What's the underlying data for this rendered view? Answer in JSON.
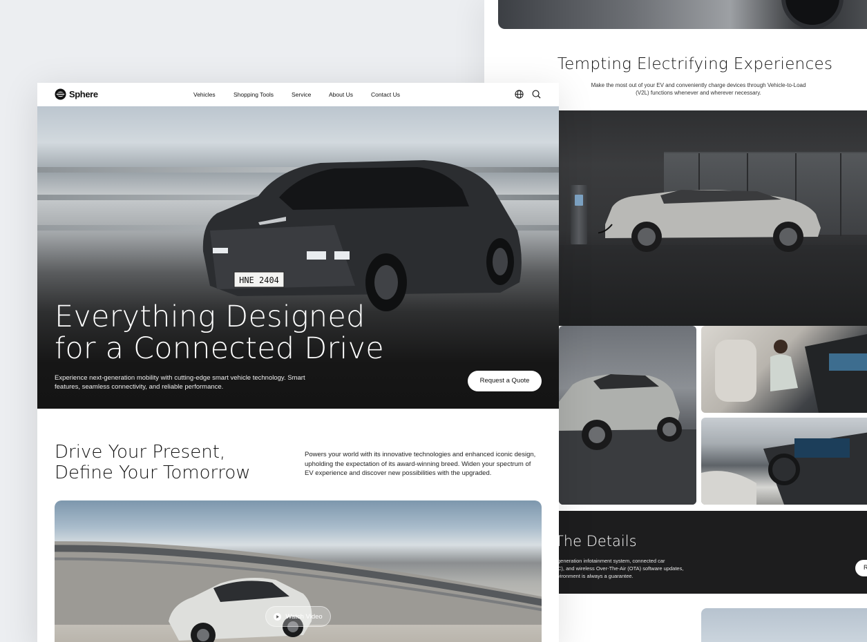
{
  "brand": {
    "name": "Sphere"
  },
  "nav": {
    "links": [
      "Vehicles",
      "Shopping Tools",
      "Service",
      "About Us",
      "Contact Us"
    ],
    "icons": [
      "globe-icon",
      "search-icon"
    ]
  },
  "hero": {
    "title_line1": "Everything Designed",
    "title_line2": "for a Connected Drive",
    "subtitle": "Experience next-generation mobility with cutting-edge smart vehicle technology. Smart features, seamless connectivity, and reliable performance.",
    "cta_label": "Request a Quote",
    "plate": "HNE 2404"
  },
  "intro": {
    "title_line1": "Drive Your Present,",
    "title_line2": "Define Your Tomorrow",
    "text": "Powers your world with its innovative technologies and enhanced iconic design, upholding the expectation of its award-winning breed. Widen your spectrum of EV experience and discover new possibilities with the upgraded."
  },
  "video": {
    "watch_label": "Watch Video"
  },
  "back_page": {
    "title": "Tempting Electrifying Experiences",
    "subtitle": "Make the most out of your EV and conveniently charge devices through Vehicle-to-Load (V2L) functions whenever and wherever necessary.",
    "details_title": "The Details",
    "details_text": "generation infotainment system, connected car\nC), and wireless Over-The-Air (OTA) software updates,\nvironment is always a guarantee.",
    "details_button": "R"
  },
  "colors": {
    "page_bg": "#eceef1",
    "dark_band": "#1d1d1e",
    "button_bg": "#ffffff"
  }
}
